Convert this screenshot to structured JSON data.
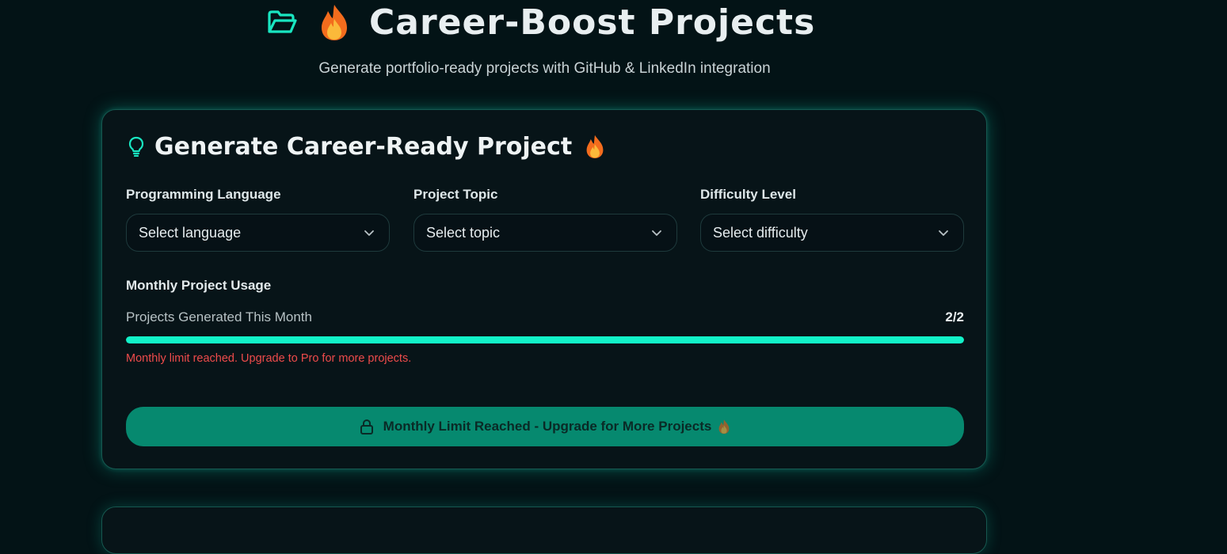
{
  "header": {
    "title": "Career-Boost Projects",
    "subtitle": "Generate portfolio-ready projects with GitHub & LinkedIn integration",
    "icons": [
      "folder-open-icon",
      "fire-icon"
    ]
  },
  "generator_card": {
    "title": "Generate Career-Ready Project",
    "icons": [
      "lightbulb-icon",
      "fire-icon"
    ],
    "fields": [
      {
        "label": "Programming Language",
        "value": "Select language"
      },
      {
        "label": "Project Topic",
        "value": "Select topic"
      },
      {
        "label": "Difficulty Level",
        "value": "Select difficulty"
      }
    ],
    "usage": {
      "heading": "Monthly Project Usage",
      "label": "Projects Generated This Month",
      "count_text": "2/2",
      "used": 2,
      "limit": 2,
      "progress_fraction": 1.0,
      "message": "Monthly limit reached. Upgrade to Pro for more projects."
    },
    "button": {
      "label": "Monthly Limit Reached - Upgrade for More Projects",
      "icons": [
        "lock-icon",
        "fire-icon"
      ]
    }
  },
  "colors": {
    "background": "#031316",
    "accent": "#12f2c8",
    "button": "#06896f",
    "error": "#ef4b4b",
    "card_border": "#16574f"
  }
}
